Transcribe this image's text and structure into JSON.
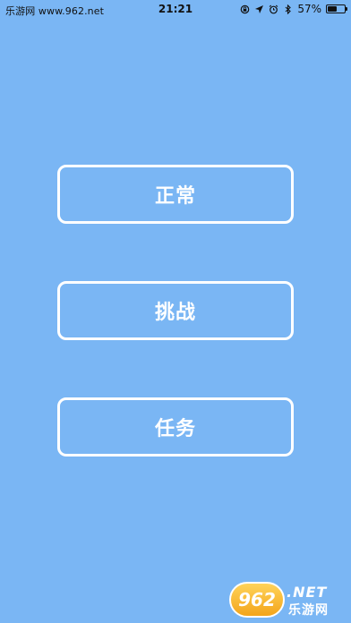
{
  "status_bar": {
    "site": "乐游网 www.962.net",
    "time": "21:21",
    "battery": "57%",
    "battery_level": 0.57
  },
  "menu": {
    "normal_label": "正常",
    "challenge_label": "挑战",
    "task_label": "任务"
  },
  "watermark": {
    "badge": "962",
    "net": ".NET",
    "sub": "乐游网"
  },
  "colors": {
    "background": "#7ab6f4",
    "button_border": "#ffffff",
    "button_text": "#ffffff"
  }
}
